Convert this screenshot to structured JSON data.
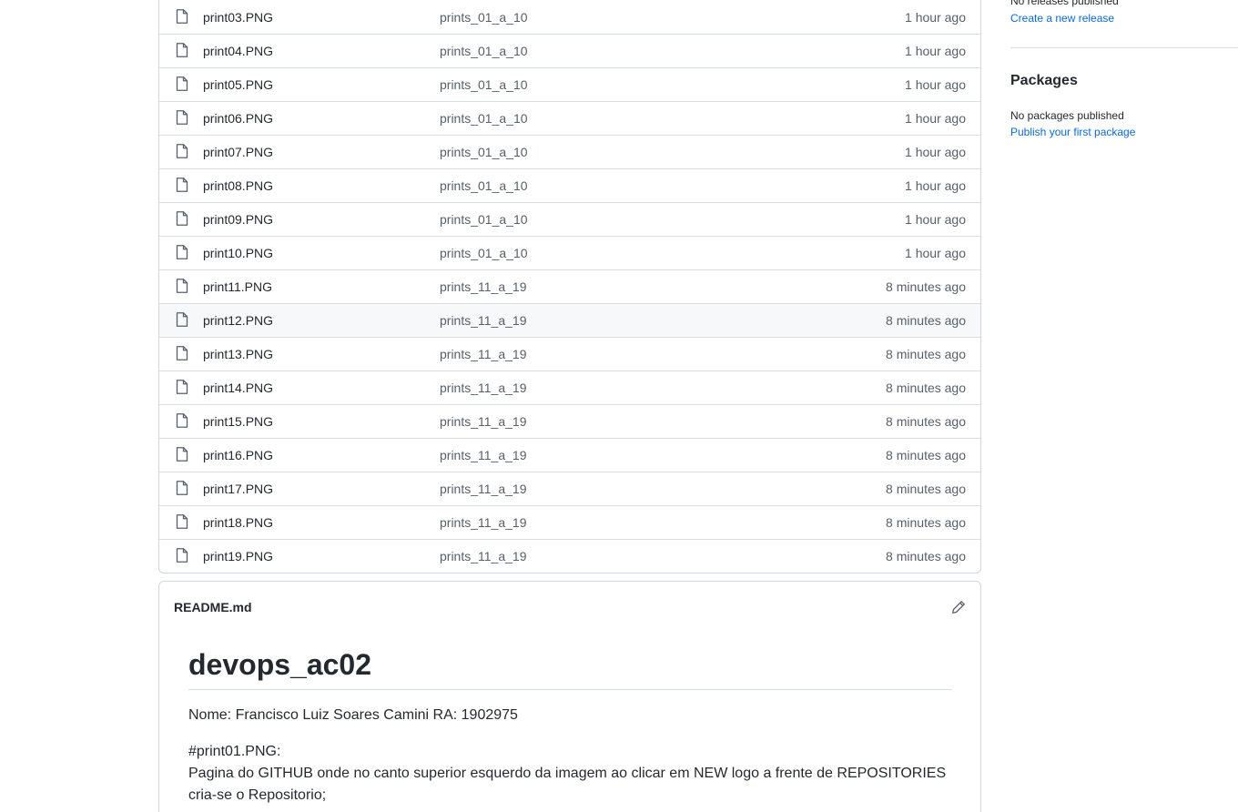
{
  "files": [
    {
      "name": "print03.PNG",
      "commit": "prints_01_a_10",
      "age": "1 hour ago"
    },
    {
      "name": "print04.PNG",
      "commit": "prints_01_a_10",
      "age": "1 hour ago"
    },
    {
      "name": "print05.PNG",
      "commit": "prints_01_a_10",
      "age": "1 hour ago"
    },
    {
      "name": "print06.PNG",
      "commit": "prints_01_a_10",
      "age": "1 hour ago"
    },
    {
      "name": "print07.PNG",
      "commit": "prints_01_a_10",
      "age": "1 hour ago"
    },
    {
      "name": "print08.PNG",
      "commit": "prints_01_a_10",
      "age": "1 hour ago"
    },
    {
      "name": "print09.PNG",
      "commit": "prints_01_a_10",
      "age": "1 hour ago"
    },
    {
      "name": "print10.PNG",
      "commit": "prints_01_a_10",
      "age": "1 hour ago"
    },
    {
      "name": "print11.PNG",
      "commit": "prints_11_a_19",
      "age": "8 minutes ago"
    },
    {
      "name": "print12.PNG",
      "commit": "prints_11_a_19",
      "age": "8 minutes ago"
    },
    {
      "name": "print13.PNG",
      "commit": "prints_11_a_19",
      "age": "8 minutes ago"
    },
    {
      "name": "print14.PNG",
      "commit": "prints_11_a_19",
      "age": "8 minutes ago"
    },
    {
      "name": "print15.PNG",
      "commit": "prints_11_a_19",
      "age": "8 minutes ago"
    },
    {
      "name": "print16.PNG",
      "commit": "prints_11_a_19",
      "age": "8 minutes ago"
    },
    {
      "name": "print17.PNG",
      "commit": "prints_11_a_19",
      "age": "8 minutes ago"
    },
    {
      "name": "print18.PNG",
      "commit": "prints_11_a_19",
      "age": "8 minutes ago"
    },
    {
      "name": "print19.PNG",
      "commit": "prints_11_a_19",
      "age": "8 minutes ago"
    }
  ],
  "readme": {
    "filename": "README.md",
    "heading": "devops_ac02",
    "paragraph1": "Nome: Francisco Luiz Soares Camini RA: 1902975",
    "paragraph2_line1": "#print01.PNG:",
    "paragraph2_line2": "Pagina do GITHUB onde no canto superior esquerdo da imagem ao clicar em NEW logo a frente de REPOSITORIES",
    "paragraph2_line3": "cria-se o Repositorio;"
  },
  "sidebar": {
    "releases_none": "No releases published",
    "releases_link": "Create a new release",
    "packages_title": "Packages",
    "packages_none": "No packages published",
    "packages_link": "Publish your first package"
  },
  "icons": {
    "file": "file-icon",
    "edit": "pencil-icon"
  },
  "colors": {
    "link": "#0969da",
    "muted": "#57606a",
    "border": "#d0d7de",
    "row_hover": "#f6f8fa"
  }
}
